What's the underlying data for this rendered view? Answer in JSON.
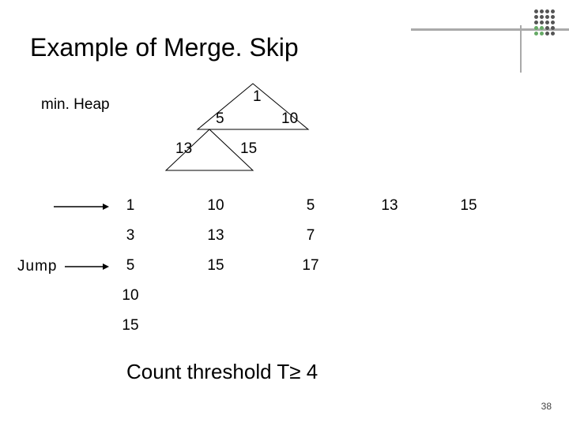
{
  "title": "Example of Merge. Skip",
  "minheap_label": "min. Heap",
  "heap": {
    "top": "1",
    "left1": "5",
    "right1": "10",
    "left2": "13",
    "right2": "15"
  },
  "columns": [
    [
      "1",
      "3",
      "5",
      "10",
      "15"
    ],
    [
      "10",
      "13",
      "15"
    ],
    [
      "5",
      "7",
      "17"
    ],
    [
      "13"
    ],
    [
      "15"
    ]
  ],
  "jump_label": "Jump",
  "threshold": "Count threshold T≥ 4",
  "pagenum": "38"
}
